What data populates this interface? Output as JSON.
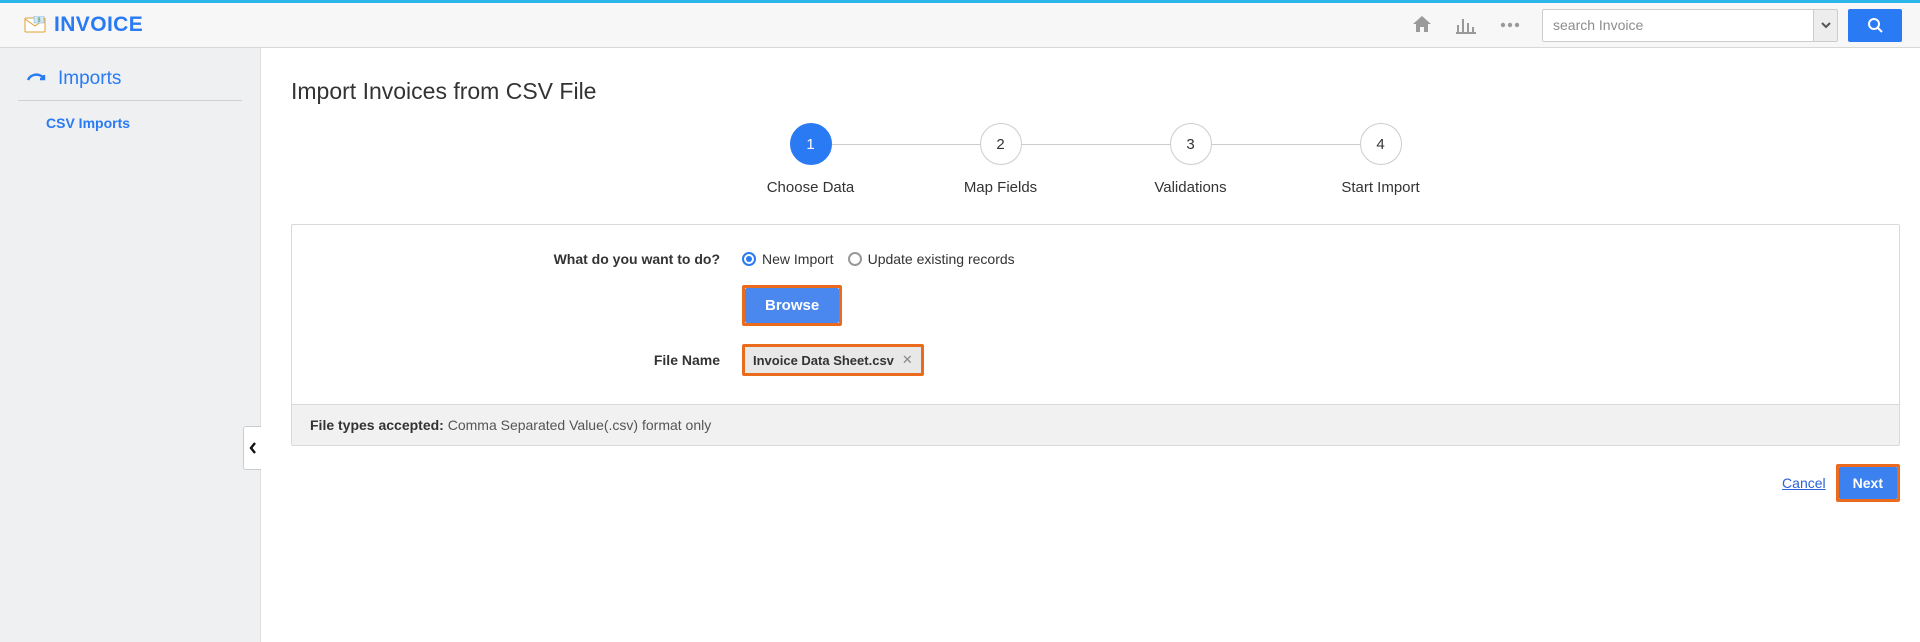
{
  "brand": {
    "name": "INVOICE"
  },
  "search": {
    "placeholder": "search Invoice"
  },
  "sidebar": {
    "header": "Imports",
    "item": "CSV Imports"
  },
  "page": {
    "title": "Import Invoices from CSV File"
  },
  "stepper": {
    "steps": [
      {
        "num": "1",
        "label": "Choose Data"
      },
      {
        "num": "2",
        "label": "Map Fields"
      },
      {
        "num": "3",
        "label": "Validations"
      },
      {
        "num": "4",
        "label": "Start Import"
      }
    ]
  },
  "form": {
    "question": "What do you want to do?",
    "opt1": "New Import",
    "opt2": "Update existing records",
    "browse": "Browse",
    "file_label": "File Name",
    "file_name": "Invoice Data Sheet.csv"
  },
  "footer": {
    "label": "File types accepted:",
    "text": " Comma Separated Value(.csv) format only"
  },
  "actions": {
    "cancel": "Cancel",
    "next": "Next"
  }
}
